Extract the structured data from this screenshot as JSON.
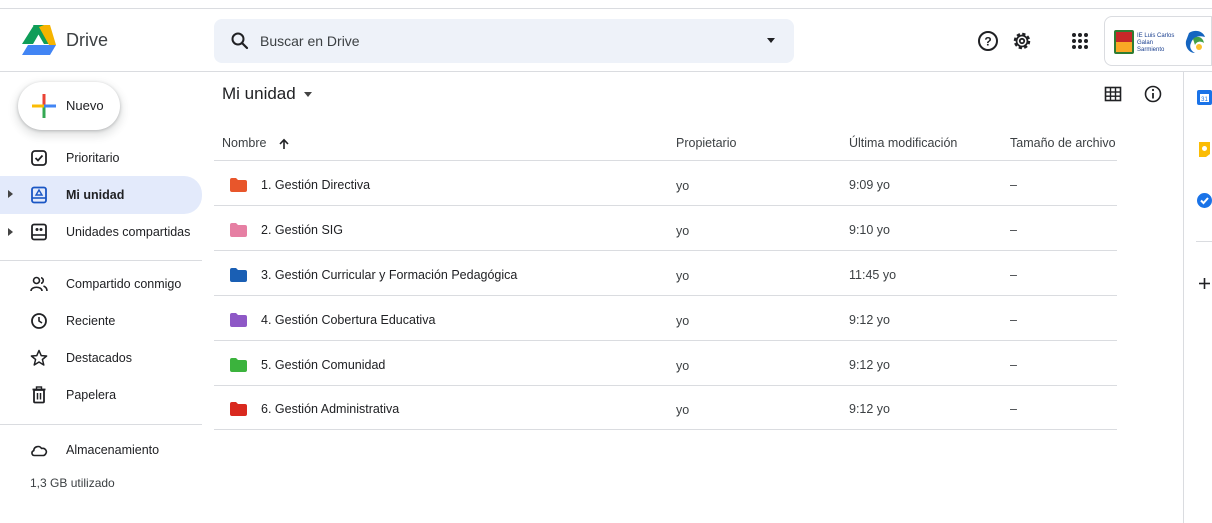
{
  "app": {
    "name": "Drive"
  },
  "search": {
    "placeholder": "Buscar en Drive"
  },
  "account": {
    "org_line1": "IE Luis Carlos",
    "org_line2": "Galan Sarmiento"
  },
  "sidebar": {
    "new_label": "Nuevo",
    "items": [
      {
        "label": "Prioritario",
        "icon": "priority-icon",
        "active": false
      },
      {
        "label": "Mi unidad",
        "icon": "my-drive-icon",
        "active": true
      },
      {
        "label": "Unidades compartidas",
        "icon": "shared-drives-icon",
        "active": false
      },
      {
        "label": "Compartido conmigo",
        "icon": "shared-with-me-icon",
        "active": false
      },
      {
        "label": "Reciente",
        "icon": "recent-icon",
        "active": false
      },
      {
        "label": "Destacados",
        "icon": "star-icon",
        "active": false
      },
      {
        "label": "Papelera",
        "icon": "trash-icon",
        "active": false
      },
      {
        "label": "Almacenamiento",
        "icon": "cloud-icon",
        "active": false
      }
    ],
    "storage_used": "1,3 GB utilizado"
  },
  "main": {
    "title": "Mi unidad",
    "columns": {
      "name": "Nombre",
      "owner": "Propietario",
      "modified": "Última modificación",
      "size": "Tamaño de archivo"
    },
    "files": [
      {
        "name": "1. Gestión Directiva",
        "owner": "yo",
        "modified": "9:09 yo",
        "size": "–",
        "color": "#e8562b"
      },
      {
        "name": "2. Gestión SIG",
        "owner": "yo",
        "modified": "9:10 yo",
        "size": "–",
        "color": "#e67fa3"
      },
      {
        "name": "3. Gestión Curricular y Formación Pedagógica",
        "owner": "yo",
        "modified": "11:45 yo",
        "size": "–",
        "color": "#1a5fb4"
      },
      {
        "name": "4. Gestión Cobertura Educativa",
        "owner": "yo",
        "modified": "9:12 yo",
        "size": "–",
        "color": "#8e58c6"
      },
      {
        "name": "5. Gestión Comunidad",
        "owner": "yo",
        "modified": "9:12 yo",
        "size": "–",
        "color": "#3bb33d"
      },
      {
        "name": "6. Gestión Administrativa",
        "owner": "yo",
        "modified": "9:12 yo",
        "size": "–",
        "color": "#d9291f"
      }
    ]
  },
  "colors": {
    "accent": "#1a73e8",
    "active_bg": "#e3eafb",
    "search_bg": "#eef2f9"
  }
}
